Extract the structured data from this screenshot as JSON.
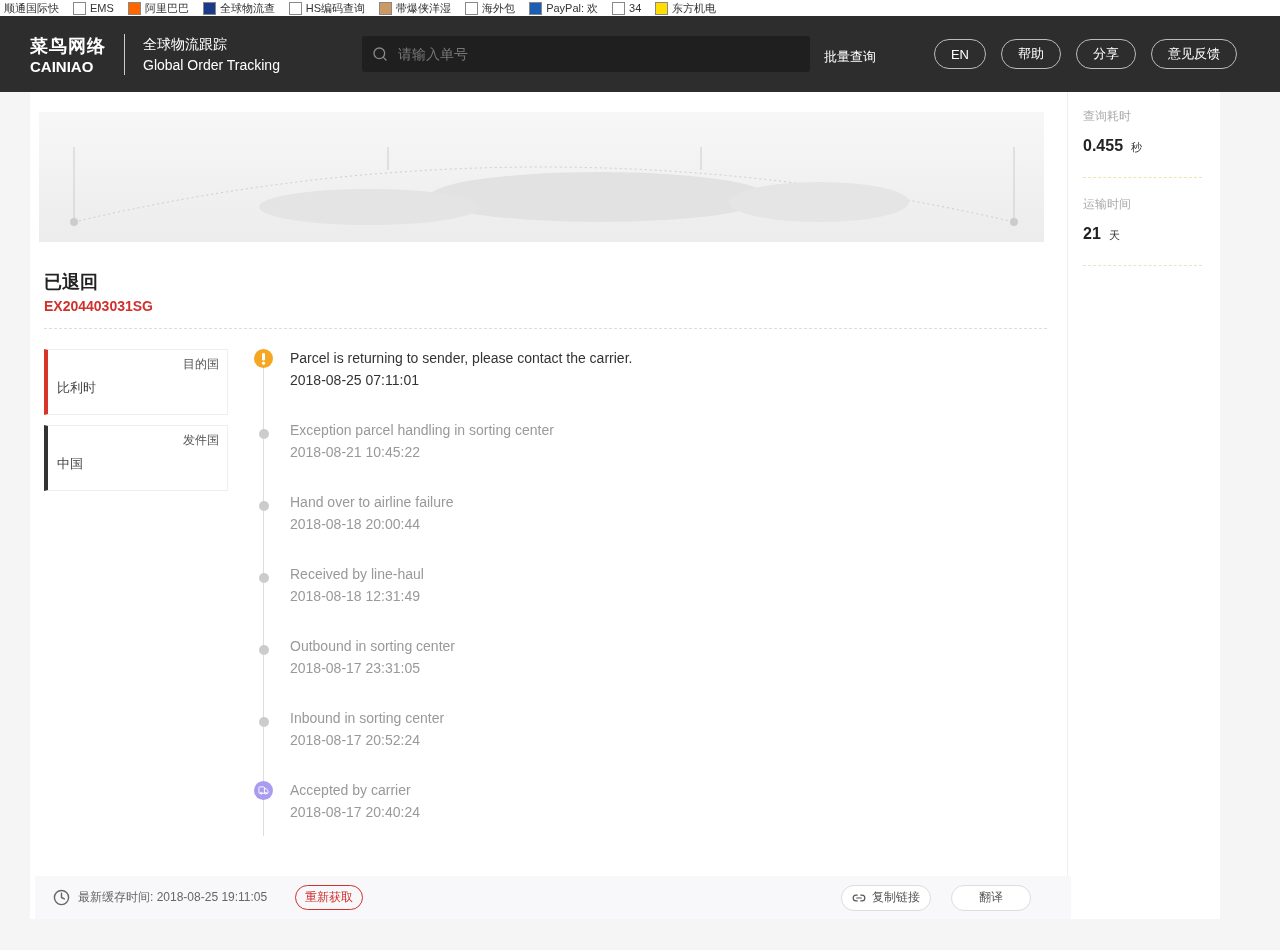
{
  "bookmarks": [
    {
      "label": "顺通国际快",
      "kind": "plain"
    },
    {
      "label": "EMS",
      "kind": "page"
    },
    {
      "label": "阿里巴巴",
      "kind": "orange"
    },
    {
      "label": "全球物流查",
      "kind": "blue"
    },
    {
      "label": "HS编码查询",
      "kind": "page"
    },
    {
      "label": "带爆侠洋湿",
      "kind": "bird"
    },
    {
      "label": "海外包",
      "kind": "page"
    },
    {
      "label": "PayPal: 欢",
      "kind": "paypal"
    },
    {
      "label": "34",
      "kind": "page"
    },
    {
      "label": "东方机电",
      "kind": "yellow"
    }
  ],
  "header": {
    "logo_cn": "菜鸟网络",
    "logo_en": "CAINIAO",
    "title_cn": "全球物流跟踪",
    "title_en": "Global Order Tracking",
    "search": {
      "placeholder": "请输入单号"
    },
    "batch_link": "批量查询",
    "buttons": [
      "EN",
      "帮助",
      "分享",
      "意见反馈"
    ]
  },
  "parcel": {
    "status": "已退回",
    "number": "EX204403031SG"
  },
  "countries": [
    {
      "role": "目的国",
      "name": "比利时",
      "color": "#d9342b"
    },
    {
      "role": "发件国",
      "name": "中国",
      "color": "#333333"
    }
  ],
  "events": [
    {
      "kind": "alert",
      "current": true,
      "text": "Parcel is returning to sender, please contact the carrier.",
      "time": "2018-08-25 07:11:01"
    },
    {
      "kind": "dot",
      "current": false,
      "text": "Exception parcel handling in sorting center",
      "time": "2018-08-21 10:45:22"
    },
    {
      "kind": "dot",
      "current": false,
      "text": "Hand over to airline failure",
      "time": "2018-08-18 20:00:44"
    },
    {
      "kind": "dot",
      "current": false,
      "text": "Received by line-haul",
      "time": "2018-08-18 12:31:49"
    },
    {
      "kind": "dot",
      "current": false,
      "text": "Outbound in sorting center",
      "time": "2018-08-17 23:31:05"
    },
    {
      "kind": "dot",
      "current": false,
      "text": "Inbound in sorting center",
      "time": "2018-08-17 20:52:24"
    },
    {
      "kind": "truck",
      "current": false,
      "text": "Accepted by carrier",
      "time": "2018-08-17 20:40:24"
    }
  ],
  "footer": {
    "cache_label": "最新缓存时间: 2018-08-25 19:11:05",
    "refresh": "重新获取",
    "copy_link": "复制链接",
    "translate": "翻译"
  },
  "stats": [
    {
      "label": "查询耗时",
      "value": "0.455",
      "unit": "秒"
    },
    {
      "label": "运输时间",
      "value": "21",
      "unit": "天"
    }
  ]
}
